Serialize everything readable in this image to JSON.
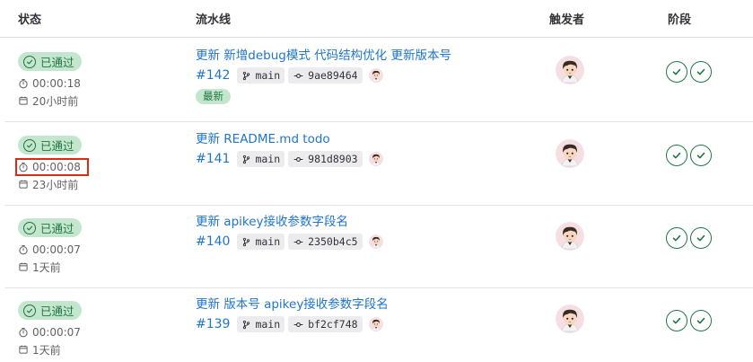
{
  "columns": {
    "status": "状态",
    "pipeline": "流水线",
    "triggerer": "触发者",
    "stages": "阶段"
  },
  "rows": [
    {
      "status_label": "已通过",
      "duration": "00:00:18",
      "finished": "20小时前",
      "title": "更新 新增debug模式 代码结构优化 更新版本号",
      "id": "#142",
      "branch": "main",
      "commit": "9ae89464",
      "tag": "最新"
    },
    {
      "status_label": "已通过",
      "duration": "00:00:08",
      "finished": "23小时前",
      "title": "更新 README.md todo",
      "id": "#141",
      "branch": "main",
      "commit": "981d8903"
    },
    {
      "status_label": "已通过",
      "duration": "00:00:07",
      "finished": "1天前",
      "title": "更新 apikey接收参数字段名",
      "id": "#140",
      "branch": "main",
      "commit": "2350b4c5"
    },
    {
      "status_label": "已通过",
      "duration": "00:00:07",
      "finished": "1天前",
      "title": "更新 版本号 apikey接收参数字段名",
      "id": "#139",
      "branch": "main",
      "commit": "bf2cf748"
    }
  ],
  "colors": {
    "success": "#217645",
    "success_bg": "#c3e6cd",
    "link": "#1f75cb",
    "highlight": "#dd2b0e"
  },
  "icons": {
    "status": "check-circle-icon",
    "duration": "timer-icon",
    "finished": "calendar-icon",
    "branch": "branch-icon",
    "commit": "commit-icon",
    "stage": "check-circle-icon"
  }
}
